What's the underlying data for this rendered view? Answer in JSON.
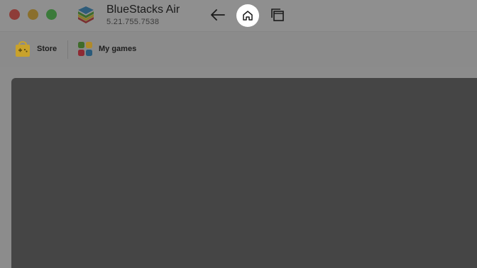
{
  "app": {
    "title": "BlueStacks Air",
    "version": "5.21.755.7538"
  },
  "window_controls": {
    "close_color": "#8e3c38",
    "minimize_color": "#8a6f2c",
    "maximize_color": "#3b7a3a"
  },
  "nav": {
    "back_icon": "arrow-left-icon",
    "home_icon": "home-icon",
    "multi_instance_icon": "multi-window-icon",
    "home_highlight_color": "#ffffff"
  },
  "toolbar": {
    "store_label": "Store",
    "store_icon": "gamepad-bag-icon",
    "my_games_label": "My games",
    "my_games_icon": "app-grid-icon"
  },
  "colors": {
    "titlebar_bg": "#8f8f8f",
    "content_bg": "#454545",
    "store_icon": "#c9a22c",
    "grid_icon": [
      "#3f6b2a",
      "#b08a2a",
      "#8e2a33",
      "#2a5a7a"
    ]
  }
}
